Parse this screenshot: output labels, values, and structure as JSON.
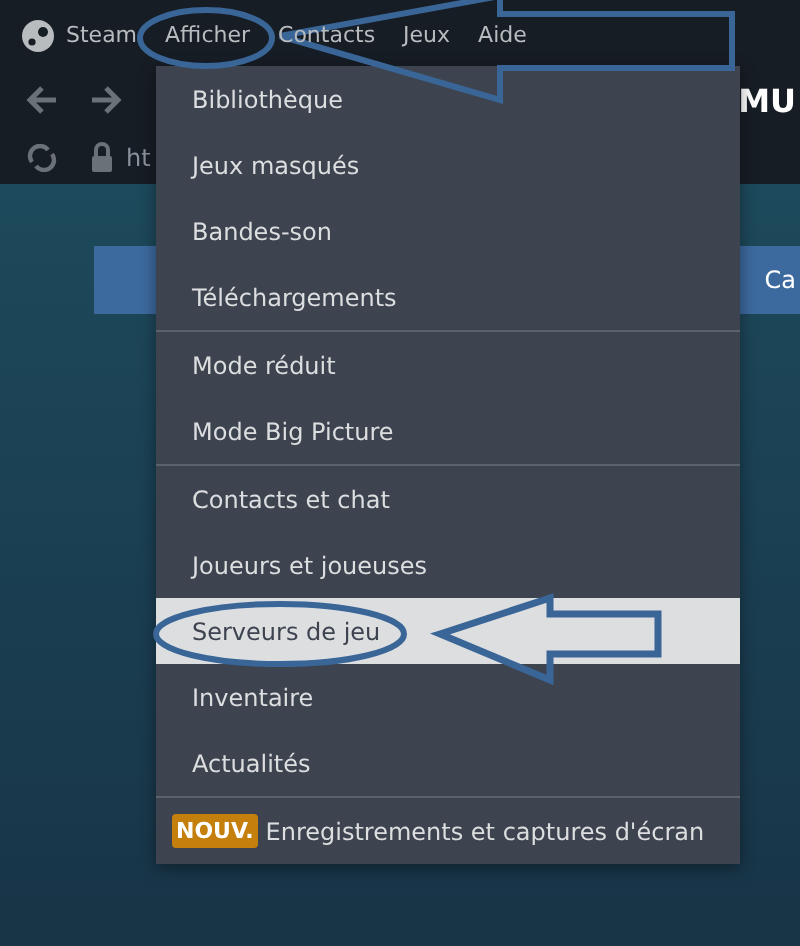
{
  "menubar": {
    "items": [
      "Steam",
      "Afficher",
      "Contacts",
      "Jeux",
      "Aide"
    ]
  },
  "nav": {
    "title": "MU"
  },
  "address": {
    "text": "ht"
  },
  "banner": {
    "button": "Ca"
  },
  "menu": {
    "sections": [
      {
        "items": [
          {
            "label": "Bibliothèque",
            "selected": false
          },
          {
            "label": "Jeux masqués",
            "selected": false
          },
          {
            "label": "Bandes-son",
            "selected": false
          },
          {
            "label": "Téléchargements",
            "selected": false
          }
        ]
      },
      {
        "items": [
          {
            "label": "Mode réduit",
            "selected": false
          },
          {
            "label": "Mode Big Picture",
            "selected": false
          }
        ]
      },
      {
        "items": [
          {
            "label": "Contacts et chat",
            "selected": false
          },
          {
            "label": "Joueurs et joueuses",
            "selected": false
          },
          {
            "label": "Serveurs de jeu",
            "selected": true
          },
          {
            "label": "Inventaire",
            "selected": false
          },
          {
            "label": "Actualités",
            "selected": false
          }
        ]
      },
      {
        "items": [
          {
            "label": "Enregistrements et captures d'écran",
            "badge": "NOUV.",
            "selected": false
          }
        ]
      }
    ]
  }
}
